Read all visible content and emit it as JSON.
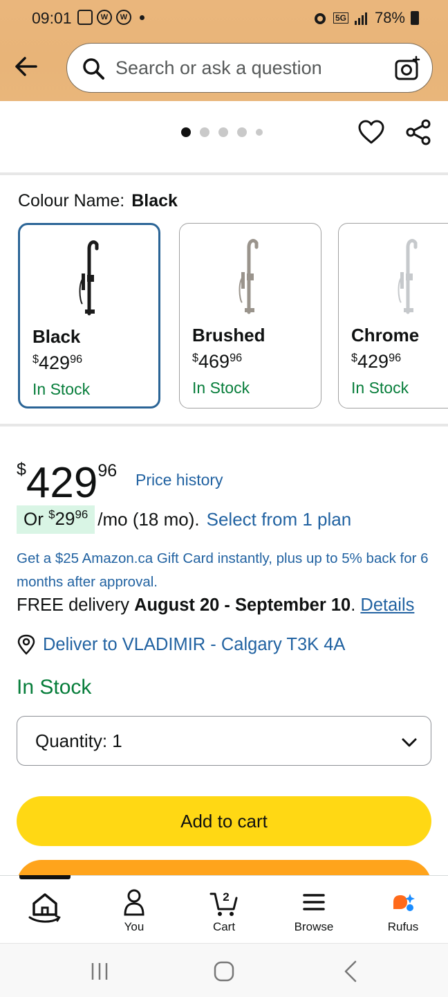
{
  "status_bar": {
    "time": "09:01",
    "battery": "78%",
    "network": "5G"
  },
  "search": {
    "placeholder": "Search or ask a question"
  },
  "carousel": {
    "count": 5,
    "active_index": 0
  },
  "colour": {
    "label": "Colour Name:",
    "selected": "Black",
    "options": [
      {
        "name": "Black",
        "price_whole": "429",
        "price_cents": "96",
        "currency": "$",
        "stock": "In Stock",
        "selected": true,
        "finish_color": "#1b1b1b"
      },
      {
        "name": "Brushed",
        "price_whole": "469",
        "price_cents": "96",
        "currency": "$",
        "stock": "In Stock",
        "selected": false,
        "finish_color": "#9a948c"
      },
      {
        "name": "Chrome",
        "price_whole": "429",
        "price_cents": "96",
        "currency": "$",
        "stock": "In Stock",
        "selected": false,
        "finish_color": "#c6c9cc"
      }
    ]
  },
  "price": {
    "currency": "$",
    "whole": "429",
    "cents": "96",
    "history_link": "Price history"
  },
  "installment": {
    "prefix": "Or",
    "currency": "$",
    "whole": "29",
    "cents": "96",
    "term": "/mo (18 mo).",
    "link": "Select from 1 plan"
  },
  "gift_card_text": "Get a $25 Amazon.ca Gift Card instantly, plus up to 5% back for 6 months after approval.",
  "delivery": {
    "prefix": "FREE delivery",
    "dates": "August 20 - September 10",
    "suffix": ".",
    "details_link": "Details"
  },
  "deliver_to": "Deliver to VLADIMIR - Calgary T3K 4A",
  "stock_status": "In Stock",
  "quantity": {
    "label": "Quantity:",
    "value": "1"
  },
  "add_to_cart": "Add to cart",
  "bottom_nav": {
    "items": [
      {
        "label": "",
        "icon": "home-icon"
      },
      {
        "label": "You",
        "icon": "user-icon"
      },
      {
        "label": "Cart",
        "icon": "cart-icon",
        "badge": "2"
      },
      {
        "label": "Browse",
        "icon": "menu-icon"
      },
      {
        "label": "Rufus",
        "icon": "rufus-icon"
      }
    ]
  },
  "colors": {
    "accent_link": "#2162a1",
    "in_stock": "#067d3a",
    "add_to_cart": "#ffd814",
    "buy_now": "#ffa41c",
    "selected_border": "#2a6496"
  }
}
